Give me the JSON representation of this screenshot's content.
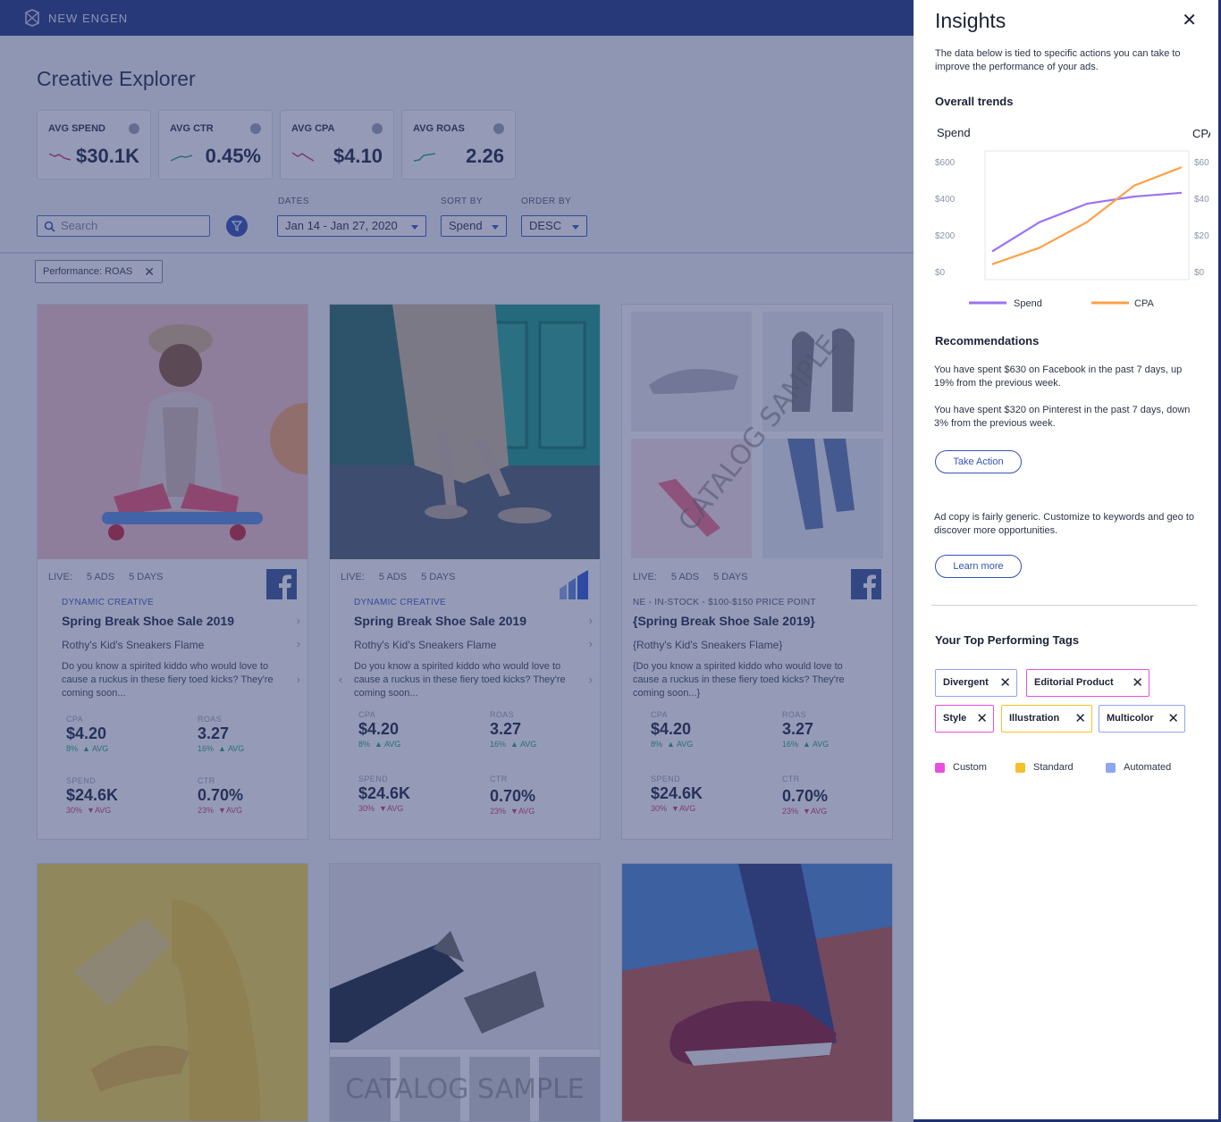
{
  "app": {
    "brand": "NEW ENGEN",
    "page_title": "Creative Explorer"
  },
  "kpis": [
    {
      "label": "AVG SPEND",
      "value": "$30.1K",
      "trend": "down",
      "color": "#d23a72"
    },
    {
      "label": "AVG CTR",
      "value": "0.45%",
      "trend": "up",
      "color": "#27a486"
    },
    {
      "label": "AVG CPA",
      "value": "$4.10",
      "trend": "down",
      "color": "#d23a72"
    },
    {
      "label": "AVG ROAS",
      "value": "2.26",
      "trend": "up",
      "color": "#27a486"
    }
  ],
  "filters": {
    "search_placeholder": "Search",
    "dates_label": "DATES",
    "dates_value": "Jan 14 - Jan 27, 2020",
    "sort_label": "SORT BY",
    "sort_value": "Spend",
    "order_label": "ORDER BY",
    "order_value": "DESC",
    "active_chip": "Performance: ROAS"
  },
  "cards": [
    {
      "live": "LIVE:",
      "ads": "5 ADS",
      "days": "5 DAYS",
      "platform": "facebook-icon",
      "kind": "DYNAMIC CREATIVE",
      "title": "Spring Break Shoe Sale 2019",
      "subtitle": "Rothy's Kid's Sneakers Flame",
      "description": "Do you know a spirited kiddo who would love to cause a ruckus in these fiery toed kicks? They're coming soon...",
      "cpa": {
        "label": "CPA",
        "value": "$4.20",
        "delta": "8%",
        "dir": "▲ AVG"
      },
      "roas": {
        "label": "ROAS",
        "value": "3.27",
        "delta": "16%",
        "dir": "▲ AVG"
      },
      "spend": {
        "label": "SPEND",
        "value": "$24.6K",
        "delta": "30%",
        "dir": "▼AVG"
      },
      "ctr": {
        "label": "CTR",
        "value": "0.70%",
        "delta": "23%",
        "dir": "▼AVG"
      }
    },
    {
      "live": "LIVE:",
      "ads": "5 ADS",
      "days": "5 DAYS",
      "platform": "bar-logo-icon",
      "kind": "DYNAMIC CREATIVE",
      "title": "Spring Break Shoe Sale 2019",
      "subtitle": "Rothy's Kid's Sneakers Flame",
      "description": "Do you know a spirited kiddo who would love to cause a ruckus in these fiery toed kicks? They're coming soon...",
      "cpa": {
        "label": "CPA",
        "value": "$4.20",
        "delta": "8%",
        "dir": "▲ AVG"
      },
      "roas": {
        "label": "ROAS",
        "value": "3.27",
        "delta": "16%",
        "dir": "▲ AVG"
      },
      "spend": {
        "label": "SPEND",
        "value": "$24.6K",
        "delta": "30%",
        "dir": "▼AVG"
      },
      "ctr": {
        "label": "CTR",
        "value": "0.70%",
        "delta": "23%",
        "dir": "▼AVG"
      }
    },
    {
      "live": "LIVE:",
      "ads": "5 ADS",
      "days": "5 DAYS",
      "platform": "facebook-icon",
      "kind": "NE - IN-STOCK - $100-$150 PRICE POINT",
      "title": "{Spring Break Shoe Sale 2019}",
      "subtitle": "{Rothy's Kid's Sneakers Flame}",
      "description": "{Do you know a spirited kiddo who would love to cause a ruckus in these fiery toed kicks? They're coming soon...}",
      "watermark": "CATALOG SAMPLE",
      "cpa": {
        "label": "CPA",
        "value": "$4.20",
        "delta": "8%",
        "dir": "▲ AVG"
      },
      "roas": {
        "label": "ROAS",
        "value": "3.27",
        "delta": "16%",
        "dir": "▲ AVG"
      },
      "spend": {
        "label": "SPEND",
        "value": "$24.6K",
        "delta": "30%",
        "dir": "▼AVG"
      },
      "ctr": {
        "label": "CTR",
        "value": "0.70%",
        "delta": "23%",
        "dir": "▼AVG"
      }
    }
  ],
  "bottom_watermark": "CATALOG SAMPLE",
  "insights": {
    "title": "Insights",
    "description": "The data below is tied to specific actions you can take to improve the performance of your ads.",
    "trends_heading": "Overall trends",
    "recommendations_heading": "Recommendations",
    "rec1": "You have spent $630 on Facebook in the past 7 days, up 19% from the previous week.",
    "rec2": "You have spent $320 on Pinterest in the past 7 days, down 3% from the previous week.",
    "take_action": "Take Action",
    "rec3": "Ad copy is fairly generic. Customize to keywords and geo to discover more opportunities.",
    "learn_more": "Learn more",
    "tags_heading": "Your Top Performing Tags",
    "tags": [
      {
        "label": "Divergent",
        "type": "automated"
      },
      {
        "label": "Editorial Product",
        "type": "custom"
      },
      {
        "label": "Style",
        "type": "custom"
      },
      {
        "label": "Illustration",
        "type": "standard"
      },
      {
        "label": "Multicolor",
        "type": "automated"
      }
    ],
    "legend": [
      {
        "label": "Custom",
        "color": "#e84fe0"
      },
      {
        "label": "Standard",
        "color": "#f5c02a"
      },
      {
        "label": "Automated",
        "color": "#8ea6f2"
      }
    ]
  },
  "chart_data": {
    "type": "line",
    "title": "",
    "ylabel_left": "Spend",
    "ylabel_right": "CPA",
    "y_left_ticks": [
      "$600",
      "$400",
      "$200",
      "$0"
    ],
    "y_right_ticks": [
      "$60",
      "$40",
      "$20",
      "$0"
    ],
    "ylim_left": [
      0,
      600
    ],
    "ylim_right": [
      0,
      60
    ],
    "x": [
      0,
      1,
      2,
      3,
      4
    ],
    "series": [
      {
        "name": "Spend",
        "axis": "left",
        "color": "#9b72f2",
        "values": [
          110,
          270,
          370,
          410,
          430
        ]
      },
      {
        "name": "CPA",
        "axis": "right",
        "color": "#ffa04a",
        "values": [
          4,
          13,
          27,
          47,
          57
        ]
      }
    ],
    "grid": false,
    "legend": "bottom"
  }
}
